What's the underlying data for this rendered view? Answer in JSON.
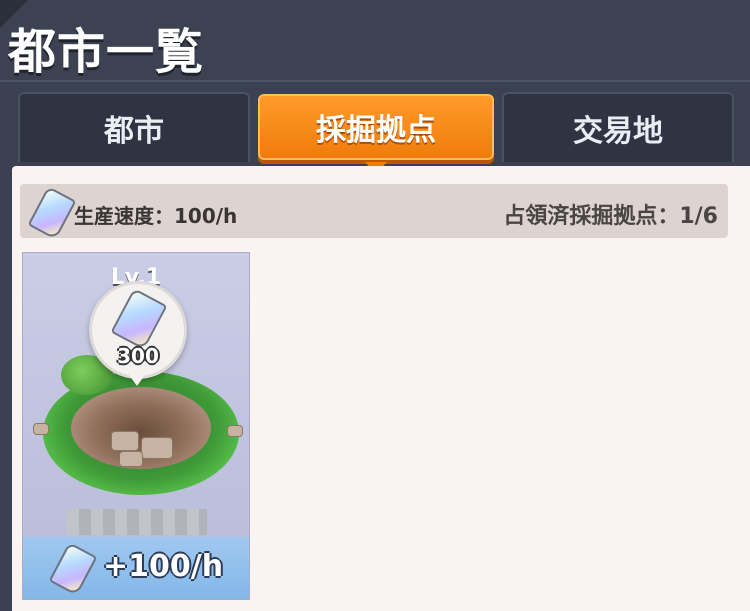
{
  "header": {
    "title": "都市一覧"
  },
  "tabs": [
    {
      "label": "都市",
      "active": false
    },
    {
      "label": "採掘拠点",
      "active": true
    },
    {
      "label": "交易地",
      "active": false
    }
  ],
  "info": {
    "production_speed": "生産速度：100/h",
    "occupied_count": "占領済採掘拠点：1/6"
  },
  "cards": [
    {
      "level": "Lv.1",
      "bubble_amount": "300",
      "rate": "+100/h"
    }
  ],
  "colors": {
    "accent": "#f07c0c",
    "header_bg": "#3d4252",
    "panel_bg": "#fbf3f1"
  },
  "icons": {
    "resource": "crystal-ore-icon"
  }
}
